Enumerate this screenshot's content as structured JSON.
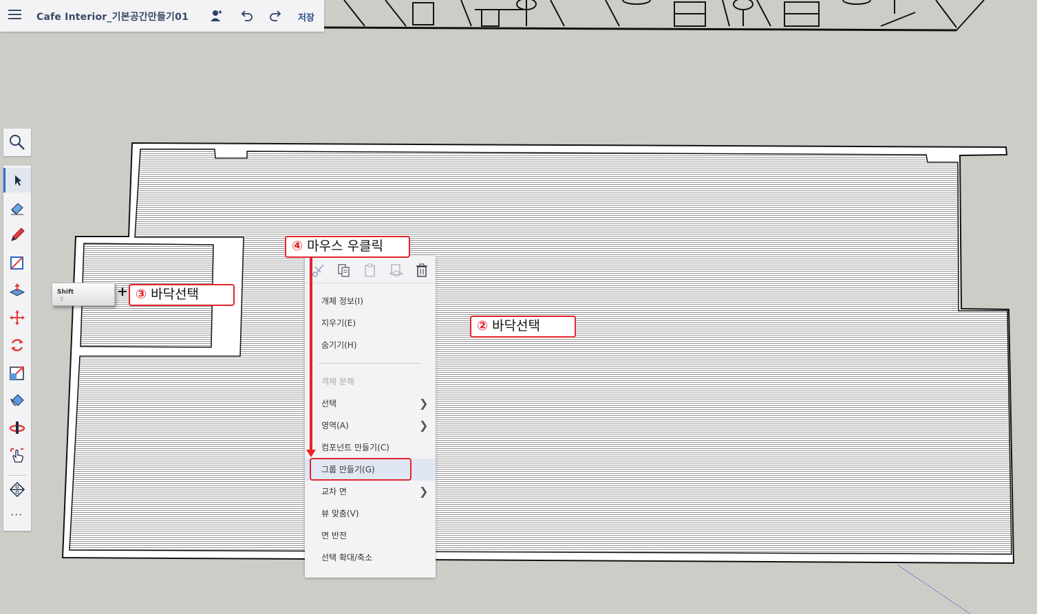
{
  "topbar": {
    "title": "Cafe Interior_기본공간만들기01",
    "save_label": "저장",
    "icons": [
      "menu-icon",
      "add-user-icon",
      "undo-icon",
      "redo-icon"
    ]
  },
  "toolbar": {
    "search_icon": "search-icon",
    "tools": [
      "select-icon",
      "eraser-icon",
      "pencil-icon",
      "rectangle-icon",
      "push-pull-icon",
      "move-icon",
      "rotate-icon",
      "scale-icon",
      "paint-bucket-icon",
      "orbit-icon",
      "pan-icon",
      "section-plane-icon"
    ],
    "more_label": "···"
  },
  "shift_key": {
    "label": "Shift",
    "arrow": "⇧"
  },
  "plus_sign": "+",
  "annotations": {
    "step2": {
      "number": "②",
      "text": "바닥선택"
    },
    "step3": {
      "number": "③",
      "text": "바닥선택"
    },
    "step4": {
      "number": "④",
      "text": "마우스 우클릭"
    }
  },
  "context_menu": {
    "icon_row": [
      "cut-icon",
      "copy-icon",
      "paste-icon",
      "paste-in-place-icon",
      "delete-icon"
    ],
    "items": [
      {
        "label": "개체 정보(I)",
        "disabled": false,
        "submenu": false
      },
      {
        "label": "지우기(E)",
        "disabled": false,
        "submenu": false
      },
      {
        "label": "숨기기(H)",
        "disabled": false,
        "submenu": false
      },
      {
        "label": "객체 분해",
        "disabled": true,
        "submenu": false
      },
      {
        "label": "선택",
        "disabled": false,
        "submenu": true
      },
      {
        "label": "영역(A)",
        "disabled": false,
        "submenu": true
      },
      {
        "label": "컴포넌트 만들기(C)",
        "disabled": false,
        "submenu": false
      },
      {
        "label": "그룹 만들기(G)",
        "disabled": false,
        "submenu": false,
        "highlighted": true
      },
      {
        "label": "교차 면",
        "disabled": false,
        "submenu": true
      },
      {
        "label": "뷰 맞춤(V)",
        "disabled": false,
        "submenu": false
      },
      {
        "label": "면 반전",
        "disabled": false,
        "submenu": false
      },
      {
        "label": "선택 확대/축소",
        "disabled": false,
        "submenu": false
      }
    ]
  },
  "colors": {
    "canvas": "#cdcdc8",
    "annotation_red": "#e3242b",
    "menu_bg": "#f3f3f6",
    "highlight": "#e0e7f3",
    "accent_blue": "#2f6ecf"
  }
}
